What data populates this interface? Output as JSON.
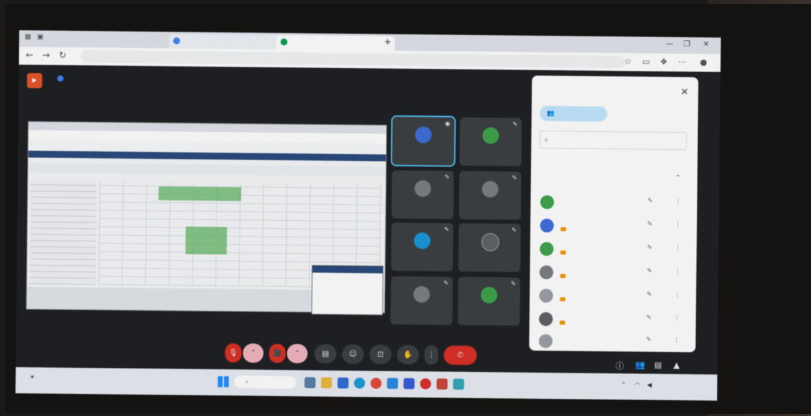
{
  "browser": {
    "tabs": [
      {
        "title": "",
        "color": "#4285f4"
      },
      {
        "title": "",
        "color": "#0f9d58"
      }
    ],
    "url": "",
    "win_controls": [
      "—",
      "❐",
      "✕"
    ]
  },
  "meet": {
    "title": "",
    "meeting_info": "",
    "tiles": [
      {
        "name": "",
        "avatar": "",
        "color": "#3f6fd8"
      },
      {
        "name": "",
        "avatar": "",
        "color": "#3fa34d"
      },
      {
        "name": "",
        "avatar": "",
        "color": "#7a7f85"
      },
      {
        "name": "",
        "avatar": "",
        "color": "#7a7f85"
      },
      {
        "name": "",
        "avatar": "",
        "color": "#1a97d6"
      },
      {
        "name": "",
        "avatar": "",
        "color": "#5f6368"
      },
      {
        "name": "",
        "avatar": "",
        "color": "#5f6368"
      },
      {
        "name": "",
        "avatar": "",
        "color": "#3fa34d"
      }
    ],
    "controls": [
      {
        "icon": "mic-off-icon",
        "glyph": "🎙"
      },
      {
        "icon": "camera-off-icon",
        "glyph": "🎥"
      },
      {
        "icon": "captions-icon",
        "glyph": "▤"
      },
      {
        "icon": "emoji-icon",
        "glyph": "☺"
      },
      {
        "icon": "present-icon",
        "glyph": "⊡"
      },
      {
        "icon": "raise-hand-icon",
        "glyph": "✋"
      },
      {
        "icon": "more-icon",
        "glyph": "⋮"
      },
      {
        "icon": "end-call-icon",
        "glyph": "✆"
      }
    ]
  },
  "people_panel": {
    "title": "",
    "add_people": "",
    "search_placeholder": "",
    "section": "",
    "group_label": "",
    "group_count": "",
    "participants": [
      {
        "name": "",
        "color": "#3fa34d",
        "avatar": ""
      },
      {
        "name": "",
        "color": "#3f6fd8",
        "avatar": ""
      },
      {
        "name": "",
        "color": "#3fa34d",
        "avatar": ""
      },
      {
        "name": "",
        "color": "#7a7f85",
        "avatar": ""
      },
      {
        "name": "",
        "color": "#9aa0a6",
        "avatar": ""
      },
      {
        "name": "",
        "color": "#5f6368",
        "avatar": ""
      },
      {
        "name": "",
        "color": "#9aa0a6",
        "avatar": ""
      }
    ]
  },
  "taskbar": {
    "search": "",
    "time": "",
    "date": "",
    "weather": ""
  },
  "colors": {
    "meet_bg": "#202124",
    "accent": "#4fc3f7",
    "end_call": "#d93025"
  }
}
